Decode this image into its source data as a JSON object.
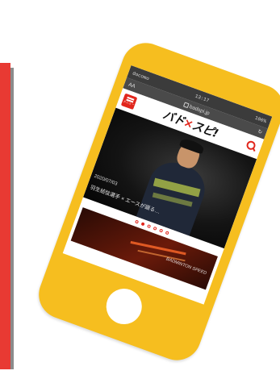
{
  "statusbar": {
    "carrier": "docomo",
    "time": "13:17",
    "battery": "100%"
  },
  "urlbar": {
    "reader_label": "AA",
    "url": "badspi.jp"
  },
  "site": {
    "menu_label": "メニュー",
    "logo_main": "バド",
    "logo_x": "×",
    "logo_end": "スピ!"
  },
  "hero": {
    "date": "2020/07/03",
    "caption": "羽生結弦選手 × エースが語る…"
  },
  "carousel": {
    "count": 6,
    "active_index": 1
  },
  "banner": {
    "text": "BADMINTON SPEED"
  },
  "colors": {
    "accent": "#e1261c",
    "phone": "#f6be1f",
    "stripe": "#e83a33"
  }
}
